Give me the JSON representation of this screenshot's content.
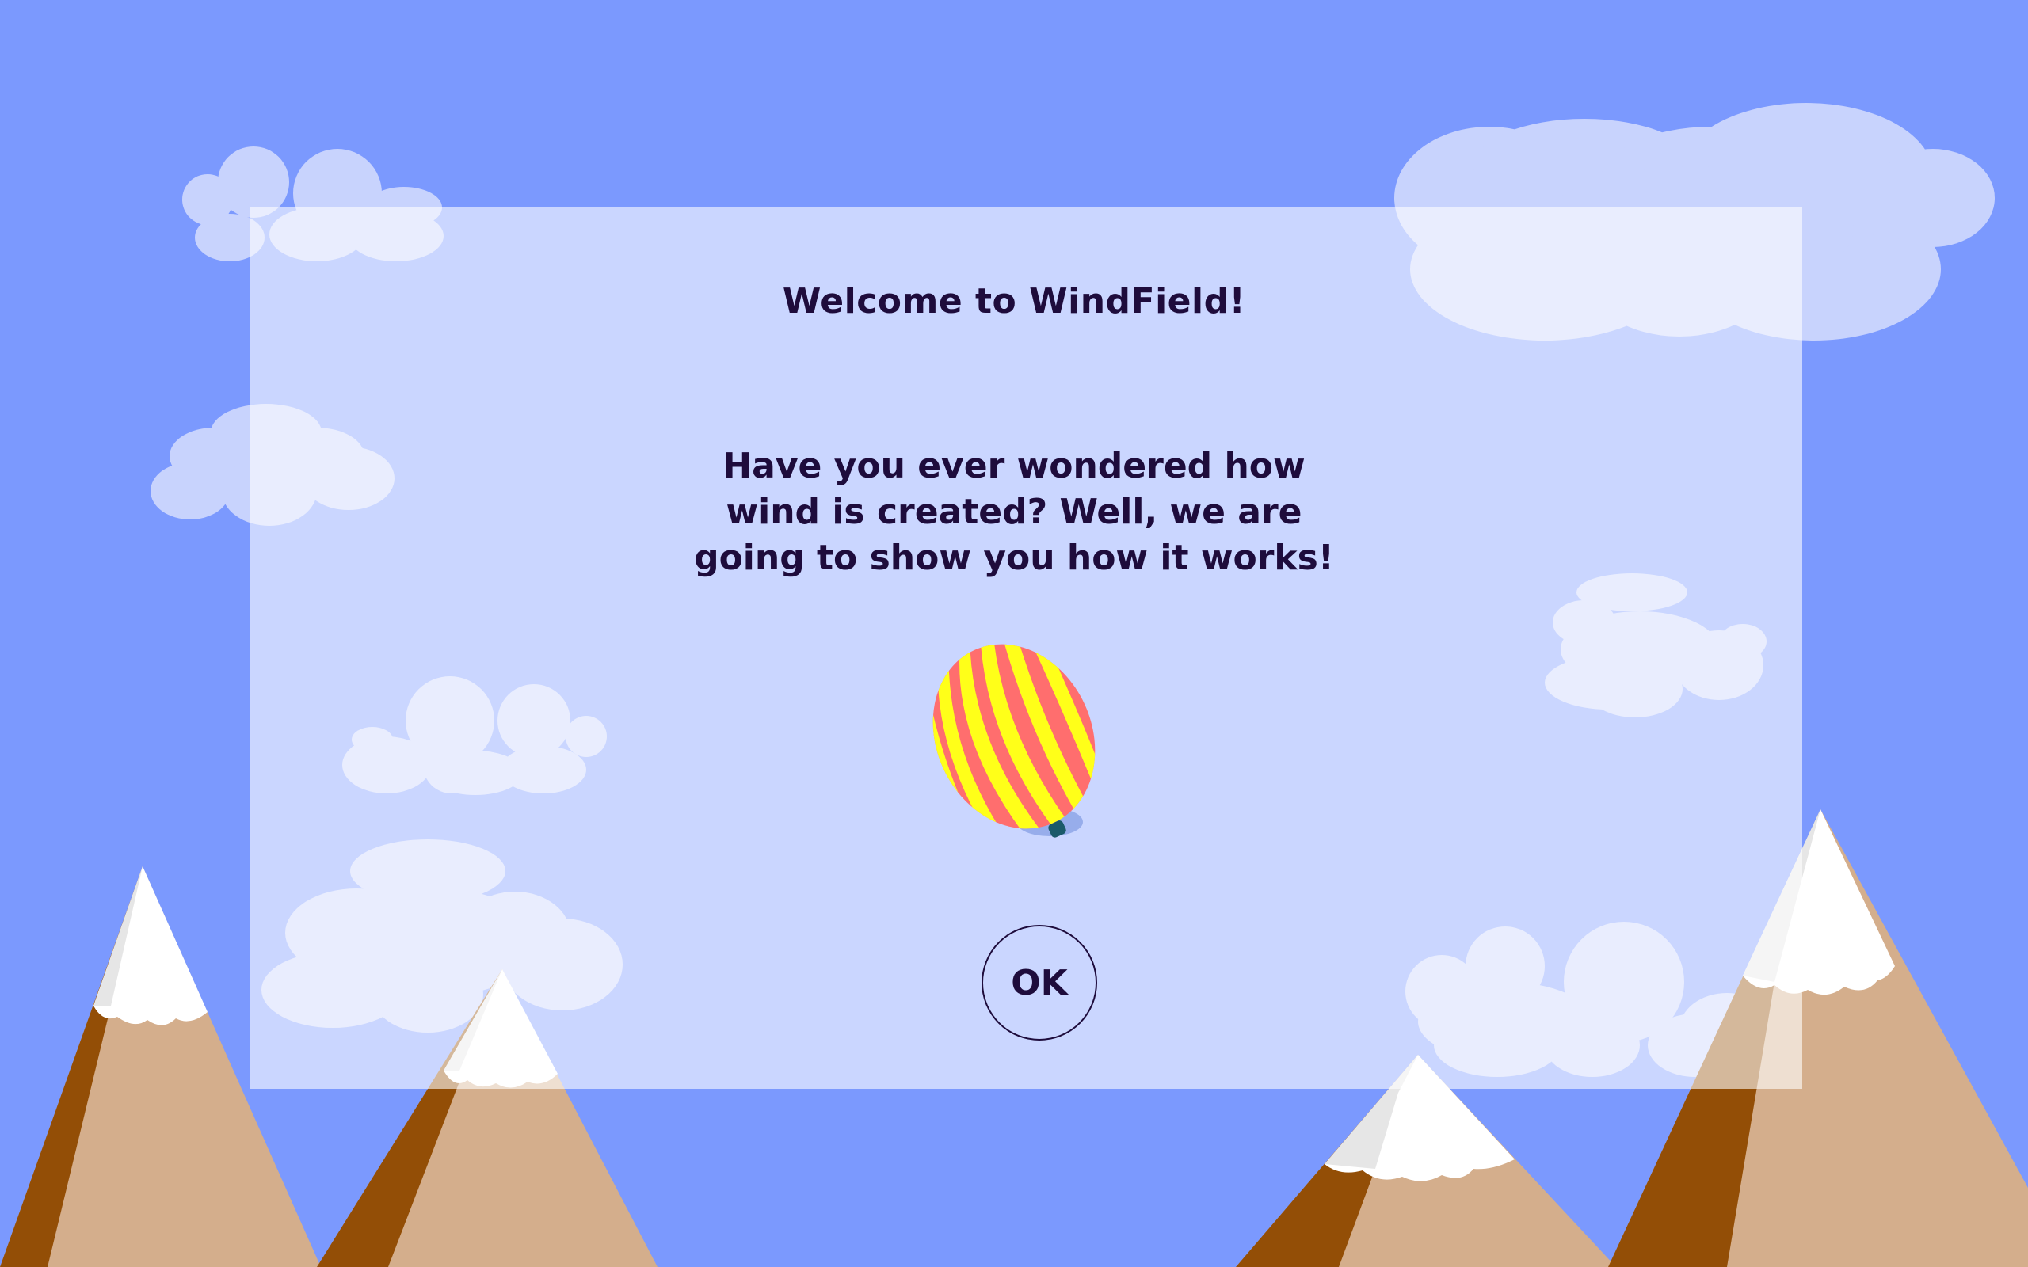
{
  "dialog": {
    "title": "Welcome to WindField!",
    "message": "Have you ever wondered how  wind is created? Well, we are going to show you how it works!",
    "ok_label": "OK"
  },
  "icons": {
    "balloon": "hot-air-balloon-icon"
  },
  "colors": {
    "sky": "#7b99fe",
    "text": "#1e0c3c",
    "mountain_light": "#d4ae8c",
    "mountain_dark": "#934e06",
    "snow": "#ffffff",
    "balloon_stripe_a": "#ffff19",
    "balloon_stripe_b": "#ff6e6e"
  }
}
